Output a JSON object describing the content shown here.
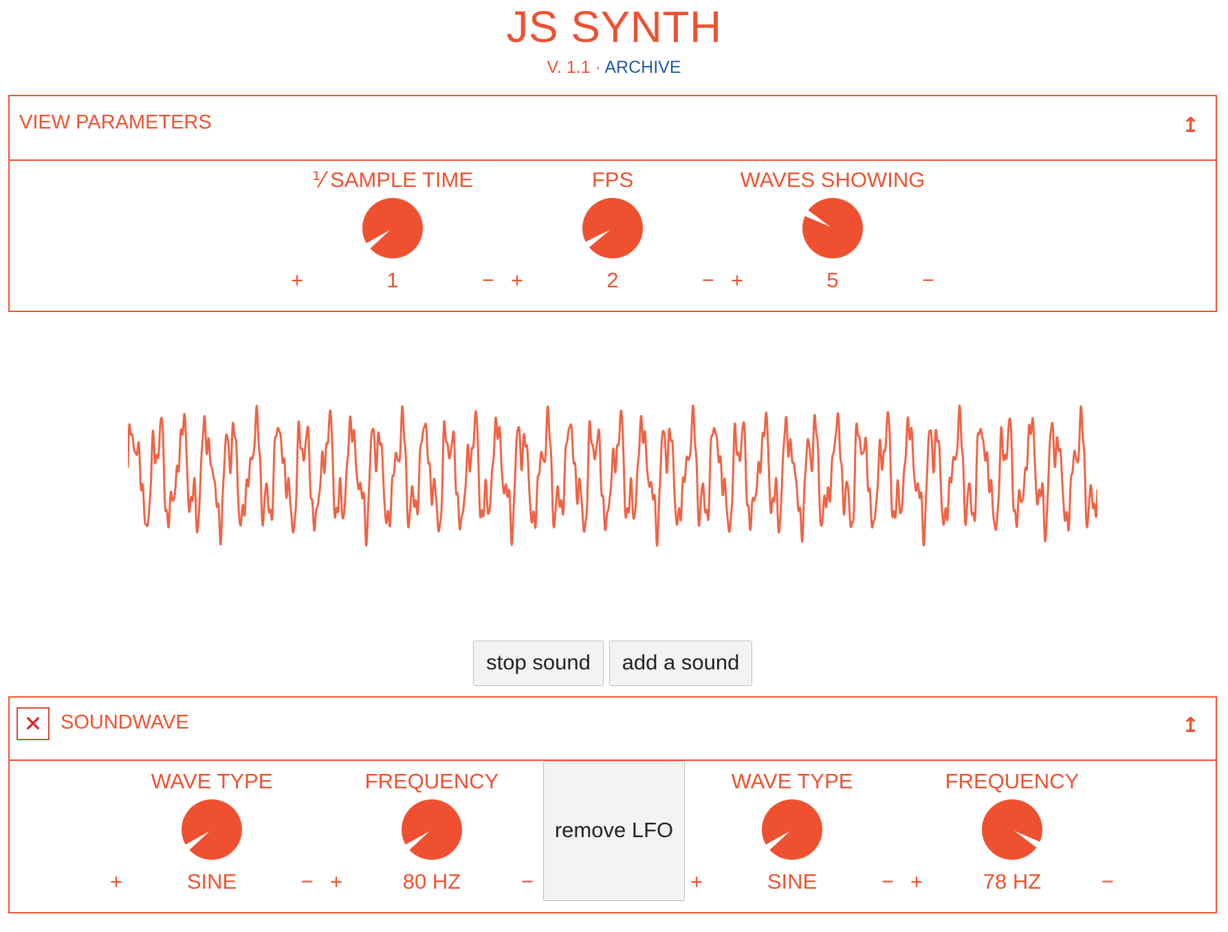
{
  "app": {
    "title": "JS SYNTH",
    "version": "V. 1.1",
    "separator": "·",
    "archive_link": "ARCHIVE"
  },
  "view_panel": {
    "title": "VIEW PARAMETERS",
    "collapse_glyph": "↥",
    "params": [
      {
        "label": "⅟ SAMPLE TIME",
        "value": "1",
        "plus": "+",
        "minus": "−",
        "level": 0.08
      },
      {
        "label": "FPS",
        "value": "2",
        "plus": "+",
        "minus": "−",
        "level": 0.09
      },
      {
        "label": "WAVES SHOWING",
        "value": "5",
        "plus": "+",
        "minus": "−",
        "level": 0.3
      }
    ]
  },
  "controls": {
    "stop_label": "stop sound",
    "add_label": "add a sound"
  },
  "sound_panel": {
    "title": "SOUNDWAVE",
    "close_glyph": "✕",
    "collapse_glyph": "↥",
    "remove_lfo_label": "remove LFO",
    "params": [
      {
        "label": "WAVE TYPE",
        "value": "SINE",
        "plus": "+",
        "minus": "−",
        "level": 0.08
      },
      {
        "label": "FREQUENCY",
        "value": "80 HZ",
        "plus": "+",
        "minus": "−",
        "level": 0.08
      },
      {
        "label": "WAVE TYPE",
        "value": "SINE",
        "plus": "+",
        "minus": "−",
        "level": 0.08
      },
      {
        "label": "FREQUENCY",
        "value": "78 HZ",
        "plus": "+",
        "minus": "−",
        "level": 0.9
      }
    ]
  },
  "colors": {
    "accent": "#ef5130",
    "link": "#1c5aa6",
    "button_bg": "#f3f3f3",
    "close_red": "#e11b1b"
  }
}
